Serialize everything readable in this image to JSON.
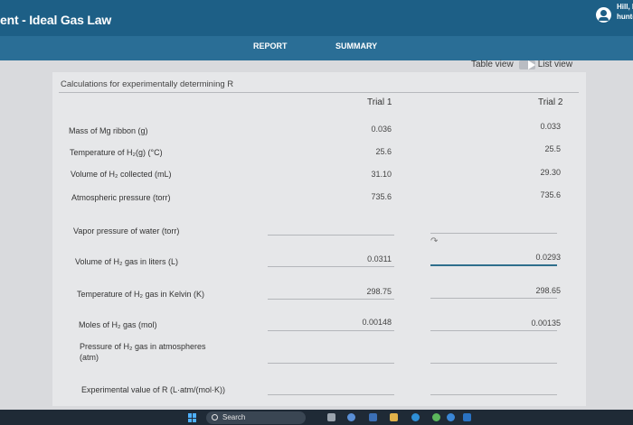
{
  "header": {
    "title": "ent - Ideal Gas Law",
    "user_line1": "Hill, H",
    "user_line2": "hunter"
  },
  "tabs": [
    {
      "label": "REPORT"
    },
    {
      "label": "SUMMARY"
    }
  ],
  "view_toggle": {
    "table_label": "Table view",
    "list_label": "List view"
  },
  "card": {
    "title": "Calculations for experimentally determining R",
    "columns": [
      "Trial 1",
      "Trial 2"
    ],
    "rows": [
      {
        "label": "Mass of Mg ribbon (g)",
        "trial1": "0.036",
        "trial2": "0.033"
      },
      {
        "label": "Temperature of H₂(g) (°C)",
        "trial1": "25.6",
        "trial2": "25.5"
      },
      {
        "label": "Volume of H₂ collected (mL)",
        "trial1": "31.10",
        "trial2": "29.30"
      },
      {
        "label": "Atmospheric pressure (torr)",
        "trial1": "735.6",
        "trial2": "735.6"
      },
      {
        "label": "Vapor pressure of water (torr)",
        "trial1": "",
        "trial2": ""
      },
      {
        "label": "Volume of H₂ gas in liters (L)",
        "trial1": "0.0311",
        "trial2": "0.0293"
      },
      {
        "label": "Temperature of H₂ gas in Kelvin (K)",
        "trial1": "298.75",
        "trial2": "298.65"
      },
      {
        "label": "Moles of H₂ gas (mol)",
        "trial1": "0.00148",
        "trial2": "0.00135"
      },
      {
        "label": "Pressure of H₂ gas in atmospheres",
        "label2": "(atm)",
        "trial1": "",
        "trial2": ""
      },
      {
        "label": "Experimental value of R (L·atm/(mol·K))",
        "trial1": "",
        "trial2": ""
      }
    ]
  },
  "taskbar": {
    "search_label": "Search"
  }
}
